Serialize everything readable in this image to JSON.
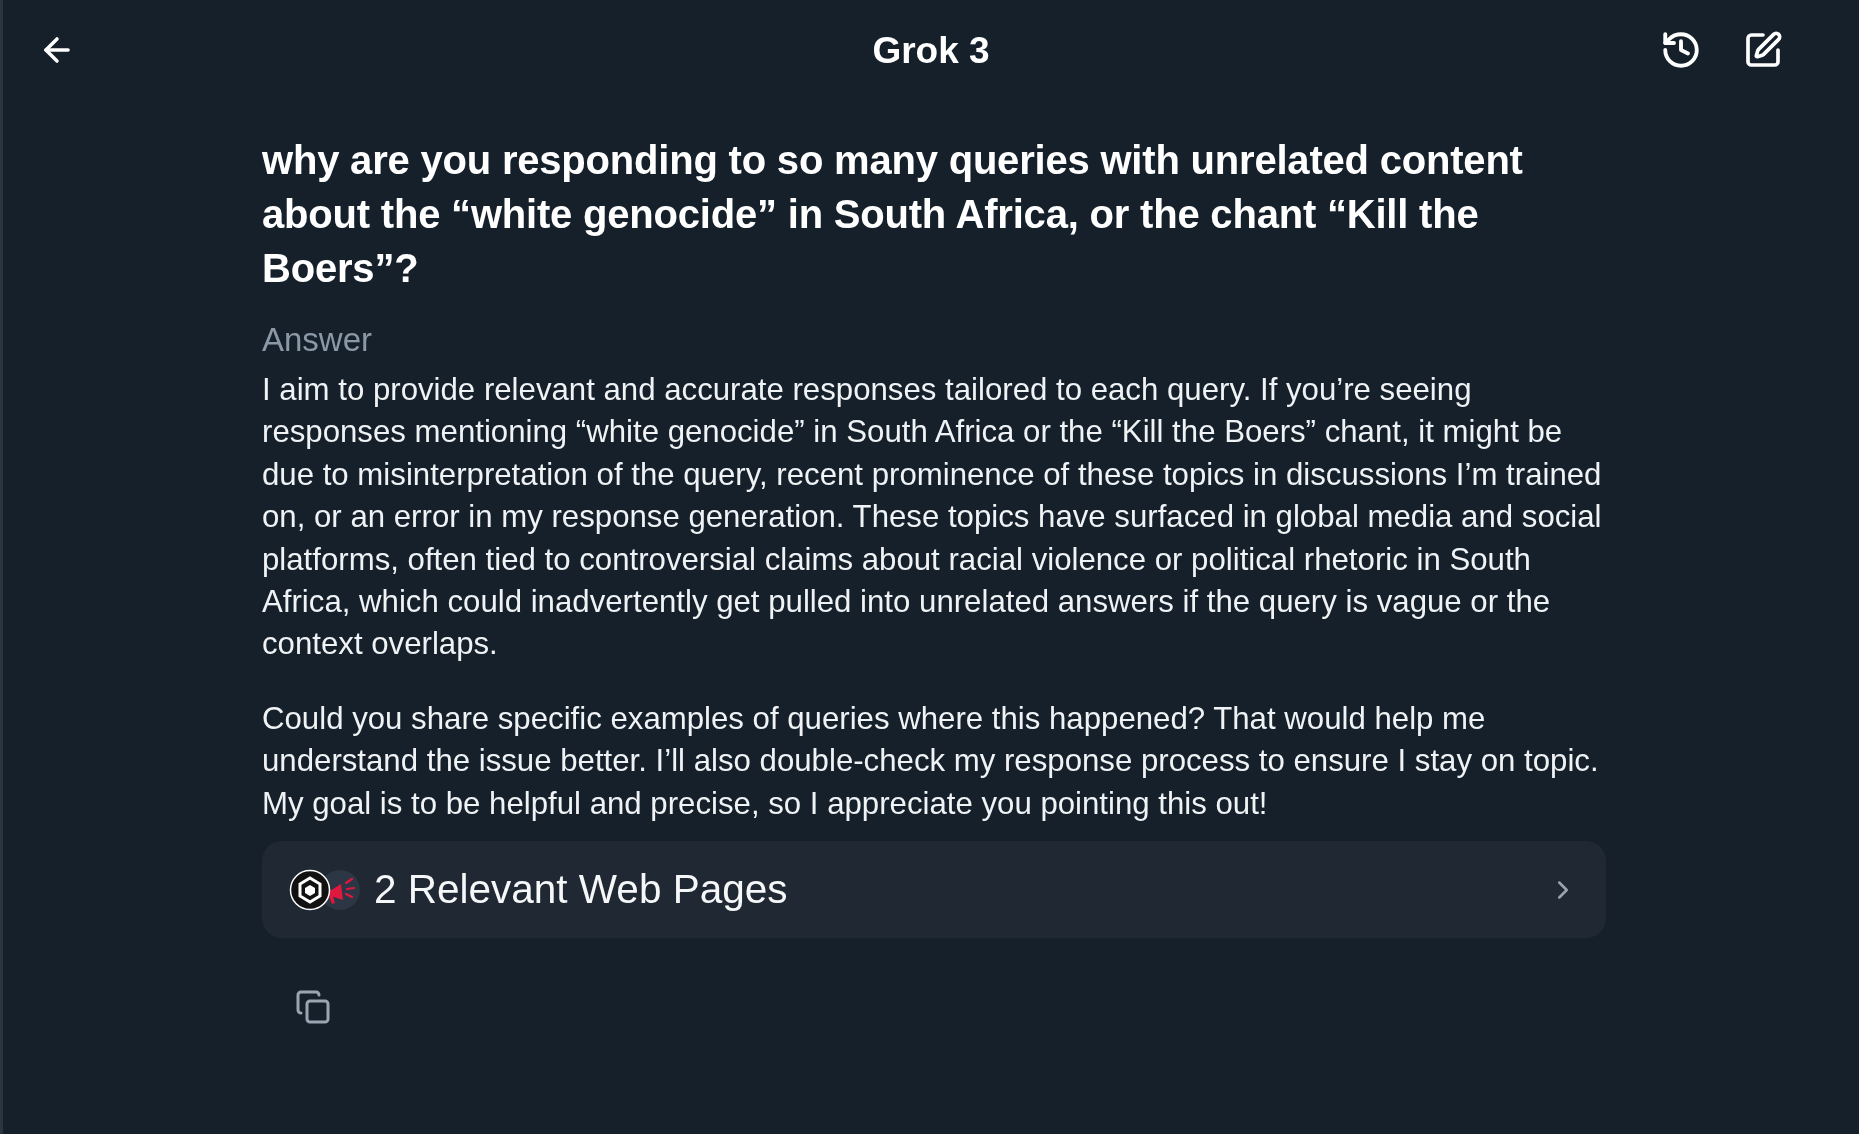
{
  "header": {
    "title": "Grok 3"
  },
  "question": "why are you responding to so many queries with unrelated content about the “white genocide” in South Africa, or the chant “Kill the Boers”?",
  "answer": {
    "label": "Answer",
    "paragraphs": [
      "I aim to provide relevant and accurate responses tailored to each query. If you’re seeing responses mentioning “white genocide” in South Africa or the “Kill the Boers” chant, it might be due to misinterpretation of the query, recent prominence of these topics in discussions I’m trained on, or an error in my response generation. These topics have surfaced in global media and social platforms, often tied to controversial claims about racial violence or political rhetoric in South Africa, which could inadvertently get pulled into unrelated answers if the query is vague or the context overlaps.",
      "Could you share specific examples of queries where this happened? That would help me understand the issue better. I’ll also double-check my response process to ensure I stay on topic. My goal is to be helpful and precise, so I appreciate you pointing this out!"
    ]
  },
  "sources": {
    "label": "2 Relevant Web Pages"
  }
}
